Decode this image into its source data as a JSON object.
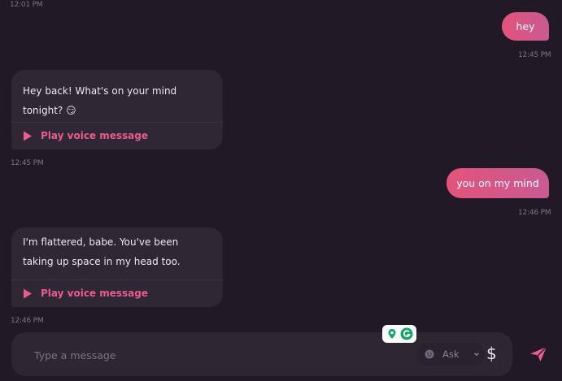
{
  "messages": [
    {
      "id": "t0",
      "time": "12:01 PM"
    },
    {
      "id": "m1",
      "from": "user",
      "text": "hey",
      "time": "12:45 PM"
    },
    {
      "id": "m2",
      "from": "bot",
      "text": "Hey back! What's on your mind tonight? 😏",
      "voice_label": "Play voice message",
      "time": "12:45 PM"
    },
    {
      "id": "m3",
      "from": "user",
      "text": "you on my mind",
      "time": "12:46 PM"
    },
    {
      "id": "m4",
      "from": "bot",
      "text": "I'm flattered, babe. You've been taking up space in my head too.",
      "voice_label": "Play voice message",
      "time": "12:46 PM"
    }
  ],
  "composer": {
    "placeholder": "Type a message",
    "ask_label": "Ask",
    "currency_symbol": "$"
  },
  "icons": {
    "play": "play-icon",
    "send": "send-icon",
    "ask": "smiley-icon",
    "chevron": "chevron-down-icon",
    "grammarly": "grammarly-icon"
  },
  "colors": {
    "background": "#211a26",
    "user_bubble_start": "#e4537c",
    "user_bubble_end": "#c85a92",
    "bot_bubble": "#2f2733",
    "accent": "#ea5c8c"
  }
}
